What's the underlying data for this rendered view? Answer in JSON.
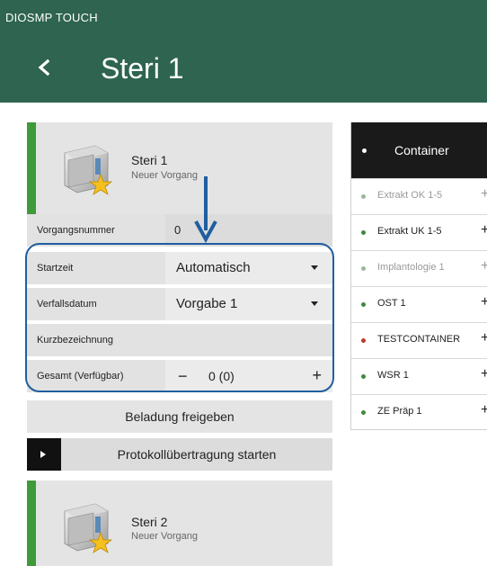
{
  "header": {
    "app_name": "DIOSMP TOUCH",
    "title": "Steri 1",
    "back_icon": "chevron-left-icon",
    "background": "#2e6450"
  },
  "sterilizers": [
    {
      "name": "Steri 1",
      "status": "Neuer Vorgang",
      "icon": "sterilizer-star-icon"
    },
    {
      "name": "Steri 2",
      "status": "Neuer Vorgang",
      "icon": "sterilizer-star-icon"
    }
  ],
  "form": {
    "process_number": {
      "label": "Vorgangsnummer",
      "value": "0"
    },
    "start_time": {
      "label": "Startzeit",
      "value": "Automatisch"
    },
    "expiry_date": {
      "label": "Verfallsdatum",
      "value": "Vorgabe 1"
    },
    "short_name": {
      "label": "Kurzbezeichnung",
      "value": ""
    },
    "total": {
      "label": "Gesamt (Verfügbar)",
      "value": "0 (0)",
      "minus": "−",
      "plus": "+"
    }
  },
  "actions": {
    "release_load": "Beladung freigeben",
    "start_protocol": "Protokollübertragung starten"
  },
  "containers": {
    "header": "Container",
    "items": [
      {
        "name": "Extrakt OK 1-5",
        "color": "#9ab89a",
        "enabled": false
      },
      {
        "name": "Extrakt UK 1-5",
        "color": "#3e8a3e",
        "enabled": true
      },
      {
        "name": "Implantologie 1",
        "color": "#9ab89a",
        "enabled": false
      },
      {
        "name": "OST 1",
        "color": "#3e8a3e",
        "enabled": true
      },
      {
        "name": "TESTCONTAINER",
        "color": "#c0392b",
        "enabled": true
      },
      {
        "name": "WSR 1",
        "color": "#3e8a3e",
        "enabled": true
      },
      {
        "name": "ZE Präp 1",
        "color": "#3e8a3e",
        "enabled": true
      }
    ],
    "add_symbol": "+"
  },
  "colors": {
    "accent_green": "#3e9a3a",
    "highlight_blue": "#1f5ea0"
  }
}
